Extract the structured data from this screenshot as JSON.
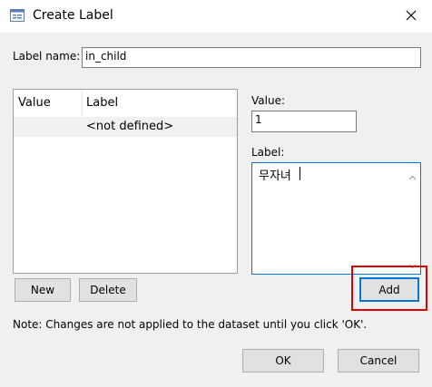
{
  "window": {
    "title": "Create Label",
    "icon": "label-window-icon",
    "close_icon": "close-icon"
  },
  "form": {
    "label_name_caption": "Label name:",
    "label_name_value": "in_child",
    "value_caption": "Value:",
    "value_value": "1",
    "label_caption": "Label:",
    "label_value": "무자녀"
  },
  "table": {
    "columns": [
      "Value",
      "Label"
    ],
    "rows": [
      {
        "value": "",
        "label": "<not defined>"
      }
    ]
  },
  "buttons": {
    "new": "New",
    "delete": "Delete",
    "add": "Add",
    "ok": "OK",
    "cancel": "Cancel"
  },
  "note": "Note: Changes are not applied to the dataset until you click 'OK'.",
  "colors": {
    "highlight": "#e00000",
    "focus_border": "#0078d7",
    "dialog_bg": "#f0f0f0"
  }
}
